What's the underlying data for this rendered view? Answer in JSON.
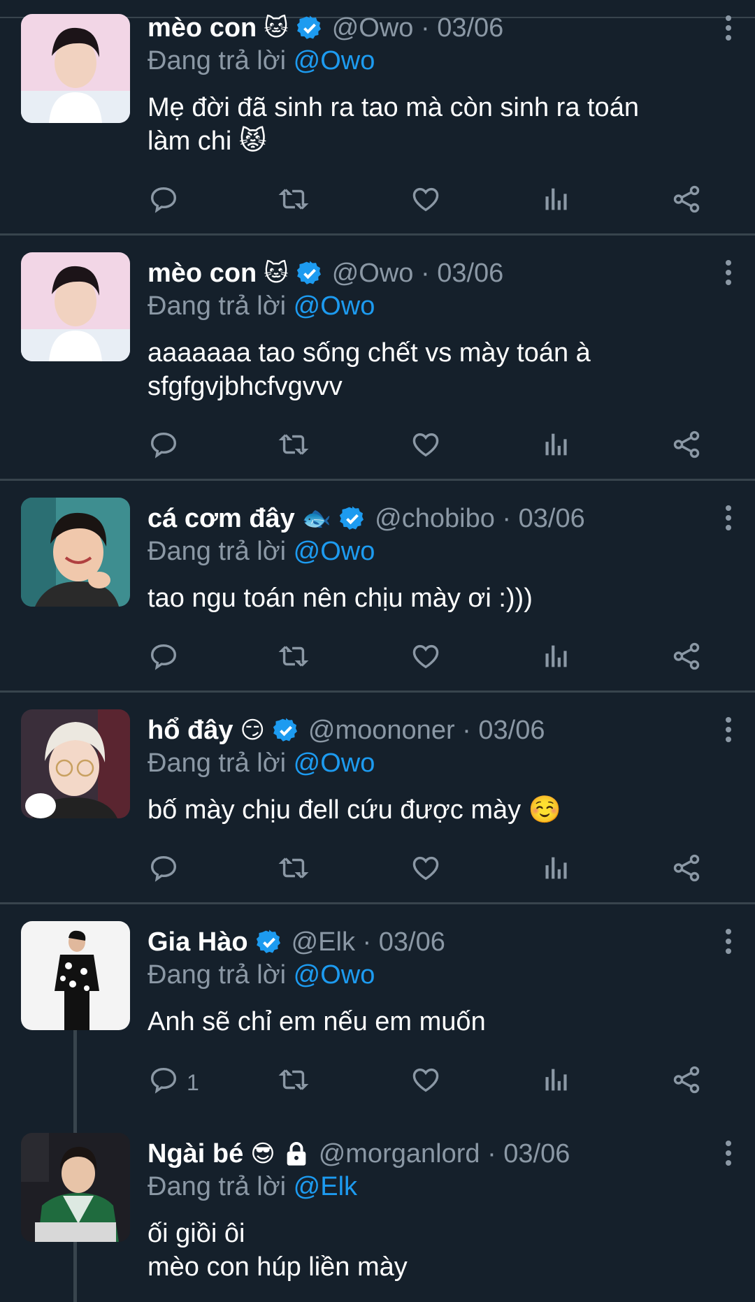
{
  "tweets": [
    {
      "name": "mèo con",
      "emoji": "🐱",
      "verified": true,
      "handle": "@Owo",
      "sep": "·",
      "date": "03/06",
      "replying_prefix": "Đang trả lời",
      "replying_to": "@Owo",
      "text": "Mẹ đời đã sinh ra tao mà còn sinh ra toán\nlàm chi 😾",
      "reply_count": "",
      "avatar": "boy-dark-hair-pink-bg"
    },
    {
      "name": "mèo con",
      "emoji": "🐱",
      "verified": true,
      "handle": "@Owo",
      "sep": "·",
      "date": "03/06",
      "replying_prefix": "Đang trả lời",
      "replying_to": "@Owo",
      "text": "aaaaaaa tao sống chết vs mày toán à\nsfgfgvjbhcfvgvvv",
      "reply_count": "",
      "avatar": "boy-dark-hair-pink-bg"
    },
    {
      "name": "cá cơm đây",
      "emoji": "🐟",
      "verified": true,
      "handle": "@chobibo",
      "sep": "·",
      "date": "03/06",
      "replying_prefix": "Đang trả lời",
      "replying_to": "@Owo",
      "text": "tao ngu toán nên chịu mày ơi :)))",
      "reply_count": "",
      "avatar": "smiling-boy-teal-bg"
    },
    {
      "name": "hổ đây",
      "emoji": "😏",
      "verified": true,
      "handle": "@moononer",
      "sep": "·",
      "date": "03/06",
      "replying_prefix": "Đang trả lời",
      "replying_to": "@Owo",
      "text": "bố mày chịu đell cứu được mày ☺️",
      "reply_count": "",
      "avatar": "blond-boy-glasses"
    },
    {
      "name": "Gia Hào",
      "emoji": "",
      "verified": true,
      "handle": "@Elk",
      "sep": "·",
      "date": "03/06",
      "replying_prefix": "Đang trả lời",
      "replying_to": "@Owo",
      "text": "Anh sẽ chỉ em nếu em muốn",
      "reply_count": "1",
      "avatar": "man-black-shirt-white-bg"
    },
    {
      "name": "Ngài bé",
      "emoji": "😎",
      "verified": false,
      "lock": true,
      "handle": "@morganlord",
      "sep": "·",
      "date": "03/06",
      "replying_prefix": "Đang trả lời",
      "replying_to": "@Elk",
      "text": "ối giồi ôi\nmèo con húp liền mày",
      "reply_count": "",
      "avatar": "gamer-green-jersey"
    }
  ],
  "icons": [
    "reply-icon",
    "retweet-icon",
    "like-icon",
    "views-icon",
    "share-icon",
    "more-icon",
    "verified-icon",
    "lock-icon"
  ],
  "colors": {
    "background": "#15202b",
    "accent": "#1d9bf0",
    "muted": "#8b98a5",
    "divider": "#38444d"
  }
}
